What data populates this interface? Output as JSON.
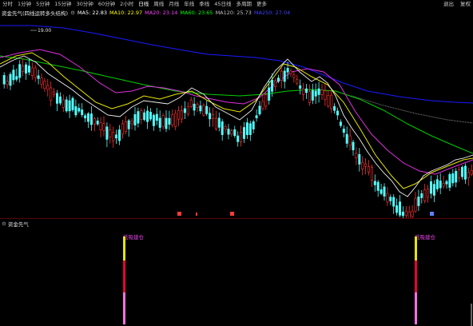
{
  "toolbar": {
    "items": [
      "分时",
      "1分钟",
      "5分钟",
      "15分钟",
      "30分钟",
      "60分钟",
      "2小时",
      "日线",
      "周线",
      "月线",
      "年线",
      "季线",
      "45日线",
      "多周期",
      "更多"
    ],
    "right": [
      "退出",
      "复权"
    ]
  },
  "legend": {
    "title": "资金先气(四线运转多头结构)",
    "ma5": "MA5: 22.83",
    "ma10": "MA10: 22.97",
    "ma20": "MA20: 23.14",
    "ma60": "MA60: 23.65",
    "ma120": "MA120: 25.73",
    "ma250": "MA250: 27.04"
  },
  "colors": {
    "up": "#ff3232",
    "down": "#54ffff",
    "ma5": "#ffffff",
    "ma10": "#ffff00",
    "ma20": "#ff40ff",
    "ma60": "#00ff00",
    "ma120": "#808080",
    "ma250": "#0000ff"
  },
  "price_annotation": "19.00",
  "indicator": {
    "title": "资金先气",
    "signal_label": "低吸建仓"
  }
}
